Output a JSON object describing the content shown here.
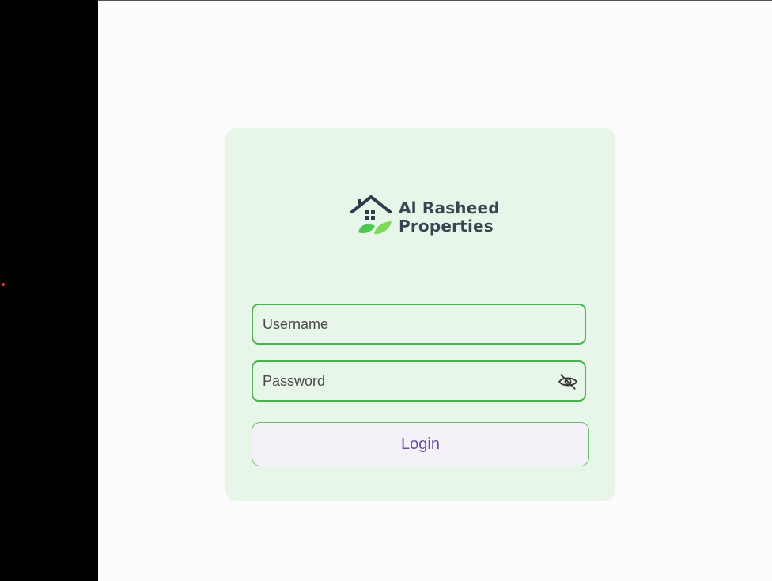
{
  "logo": {
    "line1": "Al Rasheed",
    "line2": "Properties",
    "icon": "house-leaf-logo-icon"
  },
  "form": {
    "username_placeholder": "Username",
    "username_value": "",
    "password_placeholder": "Password",
    "password_value": "",
    "password_toggle_icon": "eye-off-icon",
    "login_label": "Login"
  },
  "colors": {
    "card_background": "#e8f5e9",
    "field_border": "#4caf50",
    "button_text": "#6a4fa3",
    "app_background": "#fefbfe"
  }
}
